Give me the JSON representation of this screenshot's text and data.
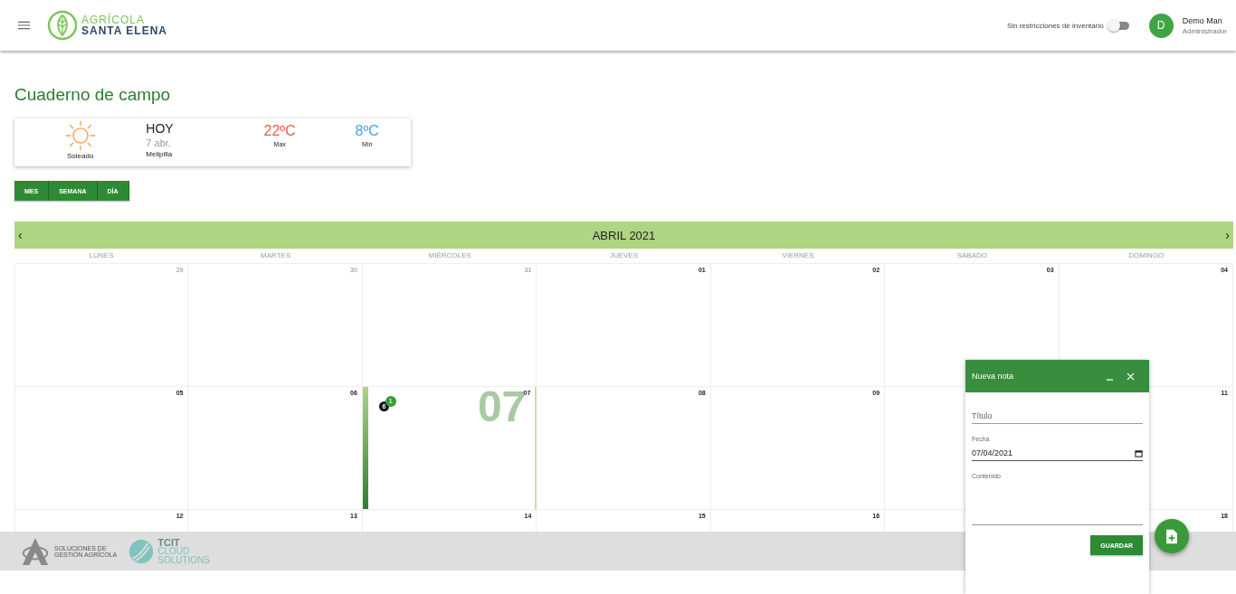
{
  "header": {
    "brand_top": "AGRÍCOLA",
    "brand_bottom": "SANTA ELENA",
    "toggle": {
      "label": "Sin restricciones de inventario",
      "on": false
    },
    "user": {
      "initial": "D",
      "name": "Demo Man",
      "role": "Administrador"
    }
  },
  "page_title": "Cuaderno de campo",
  "weather": {
    "condition": "Soleado",
    "day": "HOY",
    "date": "7 abr.",
    "place": "Melipilla",
    "max": "22ºC",
    "max_label": "Max",
    "min": "8ºC",
    "min_label": "Min"
  },
  "views": [
    {
      "label": "MES"
    },
    {
      "label": "SEMANA"
    },
    {
      "label": "DÍA"
    }
  ],
  "calendar": {
    "prev": "‹",
    "title": "ABRIL 2021",
    "next": "›",
    "weekdays": [
      "LUNES",
      "MARTES",
      "MIÉRCOLES",
      "JUEVES",
      "VIERNES",
      "SÁBADO",
      "DOMINGO"
    ],
    "weeks": [
      [
        {
          "number": "29",
          "outside": true,
          "selected": false
        },
        {
          "number": "30",
          "outside": true,
          "selected": false
        },
        {
          "number": "31",
          "outside": true,
          "selected": false
        },
        {
          "number": "01",
          "outside": false,
          "selected": false
        },
        {
          "number": "02",
          "outside": false,
          "selected": false
        },
        {
          "number": "03",
          "outside": false,
          "selected": false
        },
        {
          "number": "04",
          "outside": false,
          "selected": false
        }
      ],
      [
        {
          "number": "05",
          "outside": false,
          "selected": false
        },
        {
          "number": "06",
          "outside": false,
          "selected": false
        },
        {
          "number": "07",
          "outside": false,
          "selected": true,
          "watermark": "07",
          "events": [
            {
              "count": "6",
              "badge": "1"
            }
          ]
        },
        {
          "number": "08",
          "outside": false,
          "selected": false
        },
        {
          "number": "09",
          "outside": false,
          "selected": false
        },
        {
          "selected": false
        },
        {
          "number": "11",
          "outside": false,
          "selected": false
        }
      ],
      [
        {
          "number": "12",
          "outside": false,
          "selected": false
        },
        {
          "number": "13",
          "outside": false,
          "selected": false
        },
        {
          "number": "14",
          "outside": false,
          "selected": false
        },
        {
          "number": "15",
          "outside": false,
          "selected": false
        },
        {
          "number": "16",
          "outside": false,
          "selected": false
        },
        {
          "selected": false
        },
        {
          "number": "18",
          "outside": false,
          "selected": false
        }
      ]
    ]
  },
  "note_dialog": {
    "title": "Nueva nota",
    "title_field": {
      "placeholder": "Título"
    },
    "date_field": {
      "label": "Fecha",
      "value": "07/04/2021"
    },
    "content_field": {
      "label": "Contenido"
    },
    "save": "GUARDAR"
  },
  "footer": {
    "agri_text": [
      "SOLUCIONES DE",
      "GESTIÓN AGRÍCOLA"
    ],
    "tcit_top": "TCIT",
    "tcit_mid": "CLOUD",
    "tcit_bottom": "SOLUTIONS"
  }
}
